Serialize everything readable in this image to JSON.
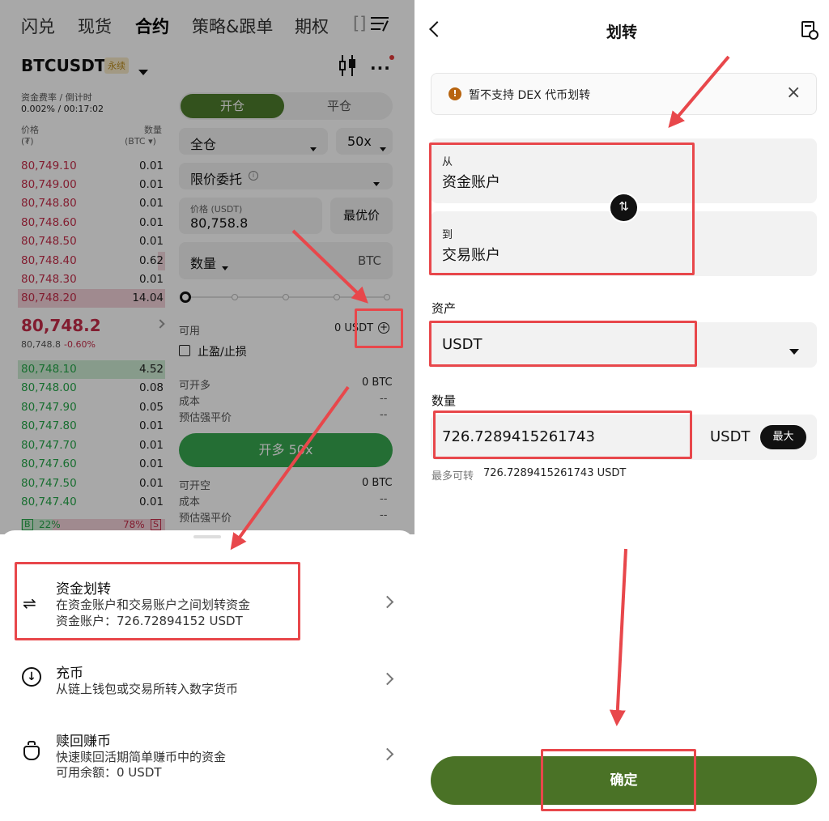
{
  "left": {
    "tabs": [
      "闪兑",
      "现货",
      "合约",
      "策略&跟单",
      "期权",
      "[]"
    ],
    "symbol": "BTCUSDT",
    "perp_badge": "永续",
    "funding_label": "资金费率 / 倒计时",
    "funding_value": "0.002% / 00:17:02",
    "ob_price_label": "价格",
    "ob_price_unit": "(₮)",
    "ob_qty_label": "数量",
    "ob_qty_unit": "(BTC ▾)",
    "asks": [
      {
        "price": "80,749.10",
        "qty": "0.01"
      },
      {
        "price": "80,749.00",
        "qty": "0.01"
      },
      {
        "price": "80,748.80",
        "qty": "0.01"
      },
      {
        "price": "80,748.60",
        "qty": "0.01"
      },
      {
        "price": "80,748.50",
        "qty": "0.01"
      },
      {
        "price": "80,748.40",
        "qty": "0.62"
      },
      {
        "price": "80,748.30",
        "qty": "0.01"
      },
      {
        "price": "80,748.20",
        "qty": "14.04"
      }
    ],
    "last_price": "80,748.2",
    "last_sub_price": "80,748.8",
    "last_change": "-0.60%",
    "bids": [
      {
        "price": "80,748.10",
        "qty": "4.52"
      },
      {
        "price": "80,748.00",
        "qty": "0.08"
      },
      {
        "price": "80,747.90",
        "qty": "0.05"
      },
      {
        "price": "80,747.80",
        "qty": "0.01"
      },
      {
        "price": "80,747.70",
        "qty": "0.01"
      },
      {
        "price": "80,747.60",
        "qty": "0.01"
      },
      {
        "price": "80,747.50",
        "qty": "0.01"
      },
      {
        "price": "80,747.40",
        "qty": "0.01"
      }
    ],
    "ratio_b_label": "B",
    "ratio_b": "22%",
    "ratio_s": "78%",
    "ratio_s_label": "S",
    "open_tab": "开仓",
    "close_tab": "平仓",
    "margin_mode": "全仓",
    "leverage": "50x",
    "order_type": "限价委托",
    "price_label": "价格 (USDT)",
    "price_value": "80,758.8",
    "best_price": "最优价",
    "qty_label": "数量",
    "qty_unit": "BTC",
    "available_label": "可用",
    "available_value": "0 USDT",
    "tpsl_label": "止盈/止损",
    "can_long_label": "可开多",
    "can_long_value": "0 BTC",
    "cost_label": "成本",
    "cost_value": "--",
    "liq_label": "预估强平价",
    "liq_value": "--",
    "open_long_btn": "开多 50x",
    "can_short_label": "可开空",
    "can_short_value": "0 BTC",
    "cost2_label": "成本",
    "cost2_value": "--",
    "liq2_label": "预估强平价",
    "liq2_value": "--",
    "sheet": {
      "items": [
        {
          "title": "资金划转",
          "desc1": "在资金账户和交易账户之间划转资金",
          "desc2": "资金账户：726.72894152 USDT"
        },
        {
          "title": "充币",
          "desc1": "从链上钱包或交易所转入数字货币",
          "desc2": ""
        },
        {
          "title": "赎回赚币",
          "desc1": "快速赎回活期简单赚币中的资金",
          "desc2": "可用余额：0 USDT"
        }
      ]
    }
  },
  "right": {
    "title": "划转",
    "notice": "暂不支持 DEX 代币划转",
    "from_label": "从",
    "from_value": "资金账户",
    "to_label": "到",
    "to_value": "交易账户",
    "asset_label": "资产",
    "asset_value": "USDT",
    "amount_label": "数量",
    "amount_value": "726.7289415261743",
    "amount_unit": "USDT",
    "max_btn": "最大",
    "max_transfer_label": "最多可转",
    "max_transfer_value": "726.7289415261743 USDT",
    "confirm_btn": "确定"
  },
  "colors": {
    "accent_green": "#4a7226",
    "ask_red": "#c62d4a",
    "bid_green": "#25a749",
    "annotation_red": "#e8474b"
  }
}
